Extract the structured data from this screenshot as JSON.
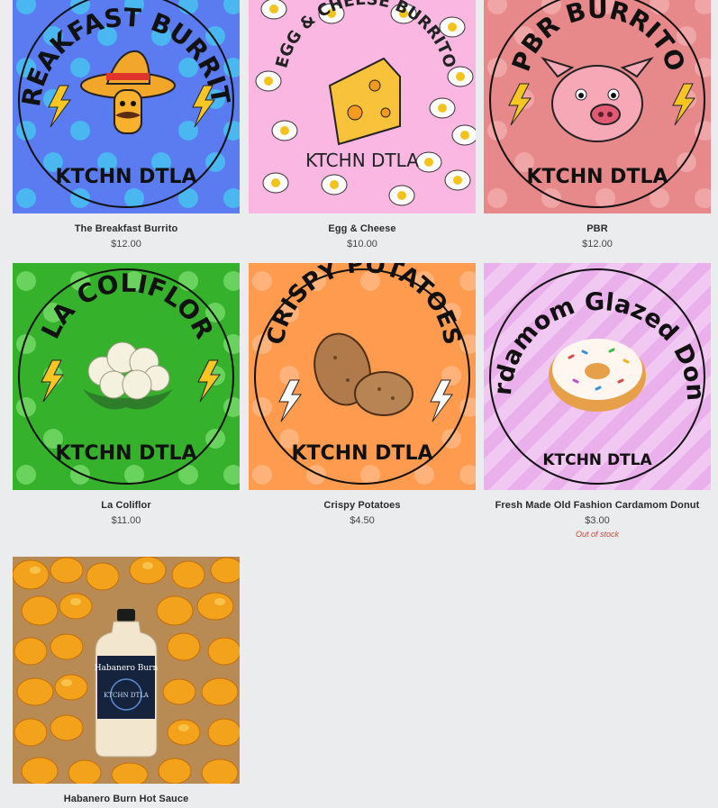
{
  "products": [
    {
      "name": "The Breakfast Burrito",
      "price": "$12.00",
      "badge_text": "BREAKFAST BURRITO",
      "brand": "KTCHN DTLA",
      "bg": "#5b7cf0",
      "dot": "#4ab7f0"
    },
    {
      "name": "Egg & Cheese",
      "price": "$10.00",
      "badge_text": "EGG & CHEESE BURRITO",
      "brand": "KTCHN DTLA",
      "bg": "#f9b7e2",
      "dot": "#ffffff"
    },
    {
      "name": "PBR",
      "price": "$12.00",
      "badge_text": "PBR BURRITO",
      "brand": "KTCHN DTLA",
      "bg": "#e7898a",
      "dot": "#f0a6a6"
    },
    {
      "name": "La Coliflor",
      "price": "$11.00",
      "badge_text": "LA COLIFLOR",
      "brand": "KTCHN DTLA",
      "bg": "#35b12c",
      "dot": "#6ad35e"
    },
    {
      "name": "Crispy Potatoes",
      "price": "$4.50",
      "badge_text": "CRISPY POTATOES",
      "brand": "KTCHN DTLA",
      "bg": "#ff9b4e",
      "dot": "#ffb27a"
    },
    {
      "name": "Fresh Made Old Fashion Cardamom Donut",
      "price": "$3.00",
      "stock": "Out of stock",
      "badge_text": "Cardamom Glazed Donut",
      "brand": "KTCHN DTLA",
      "bg": "#f1c8f2",
      "dot": "#e9b0ec"
    },
    {
      "name": "Habanero Burn Hot Sauce",
      "price": "",
      "bottle_label": "Habanero Burn",
      "bottle_brand": "KTCHN DTLA",
      "bg": "#f2a31b"
    }
  ],
  "icons": [
    "sombrero-burrito-icon",
    "cheese-icon",
    "pig-icon",
    "cauliflower-icon",
    "potato-icon",
    "donut-icon",
    "lightning-icon"
  ],
  "colors": {
    "background": "#ebecee",
    "out_of_stock": "#d0463c"
  }
}
